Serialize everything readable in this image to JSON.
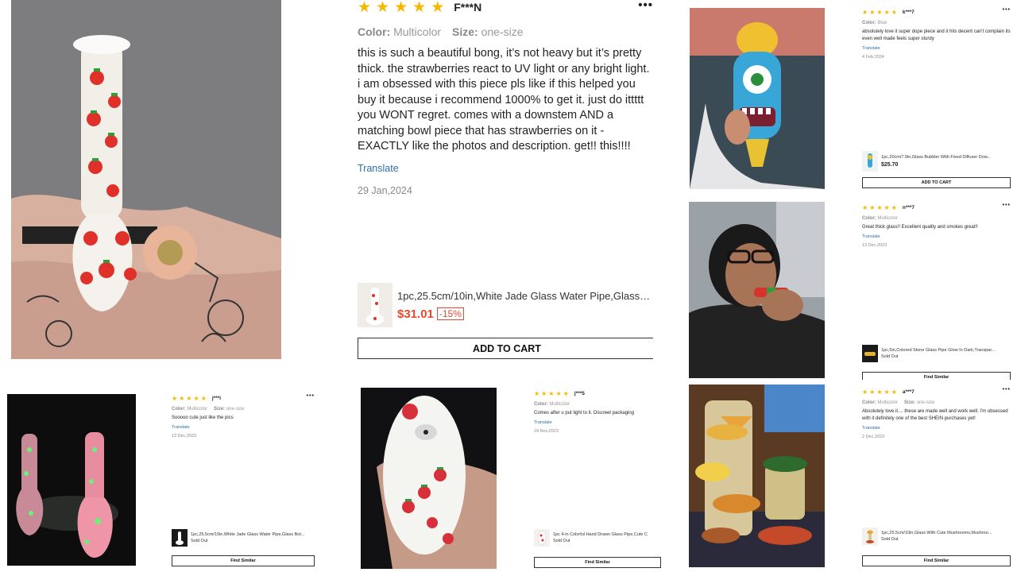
{
  "colors": {
    "star": "#f5b800",
    "price": "#e8482f",
    "link": "#2d6fa8"
  },
  "reviews": [
    {
      "stars": 5,
      "user": "F***N",
      "attrs": [
        {
          "key": "Color:",
          "value": "Multicolor"
        },
        {
          "key": "Size:",
          "value": "one-size"
        }
      ],
      "text": "this is such a beautiful bong, it’s not heavy but it’s pretty thick. the strawberries react to UV light or any bright light. i am obsessed with this piece pls like if this helped you buy it because i recommend 1000% to get it. just do ittttt you WONT regret. comes with a downstem AND a matching bowl piece that has strawberries on it - EXACTLY like the photos and description. get!! this!!!!",
      "translate": "Translate",
      "date": "29 Jan,2024",
      "product": {
        "name": "1pc,25.5cm/10in,White Jade Glass Water Pipe,Glass Bot...",
        "price": "$31.01",
        "discount": "-15%"
      },
      "button": "ADD TO CART"
    },
    {
      "stars": 5,
      "user": "k***7",
      "attrs": [
        {
          "key": "Color:",
          "value": "Blue"
        }
      ],
      "text": "absolutely love it super dope piece and it hits decent can't complain its even well made feels super sturdy",
      "translate": "Translate",
      "date": "4 Feb,2024",
      "product": {
        "name": "1pc,20cm/7.9in,Glass Bubbler With Fixed Diffuser Dow...",
        "price": "$25.70"
      },
      "button": "ADD TO CART"
    },
    {
      "stars": 5,
      "user": "n***7",
      "attrs": [
        {
          "key": "Color:",
          "value": "Multicolor"
        }
      ],
      "text": "Great thick glass!! Excellent quality and smokes great!!",
      "translate": "Translate",
      "date": "13 Dec,2023",
      "product": {
        "name": "1pc,5in,Colored Stone Glass Pipe Glow In Dark,Transpar...",
        "status": "Sold Out"
      },
      "button": "Find Similar"
    },
    {
      "stars": 5,
      "user": "j***i",
      "attrs": [
        {
          "key": "Color:",
          "value": "Multicolor"
        },
        {
          "key": "Size:",
          "value": "one-size"
        }
      ],
      "text": "Sooooo cute just like the pics",
      "translate": "Translate",
      "date": "13 Dec,2023",
      "product": {
        "name": "1pc,25.5cm/10in,White Jade Glass Water Pipe,Glass Bot...",
        "status": "Sold Out"
      },
      "button": "Find Similar"
    },
    {
      "stars": 5,
      "user": "j***5",
      "attrs": [
        {
          "key": "Color:",
          "value": "Multicolor"
        }
      ],
      "text": "Comes after u put light to it. Discreet packaging",
      "translate": "Translate",
      "date": "24 Nov,2023",
      "product": {
        "name": "1pc 4-in Colorful Hand Drawn Glass Pipe,Cute C",
        "status": "Sold Out"
      },
      "button": "Find Similar"
    },
    {
      "stars": 5,
      "user": "a***7",
      "attrs": [
        {
          "key": "Color:",
          "value": "Multicolor"
        },
        {
          "key": "Size:",
          "value": "one-size"
        }
      ],
      "text": "Absolutely love it.... these are made well and work well. I'm obsessed with it definitely one of the best SHEIN purchases yet!",
      "translate": "Translate",
      "date": "2 Dec,2023",
      "product": {
        "name": "1pc,25.5cm/10in,Glass With Cute Mushrooms,Mushroo...",
        "status": "Sold Out"
      },
      "button": "Find Similar"
    }
  ]
}
